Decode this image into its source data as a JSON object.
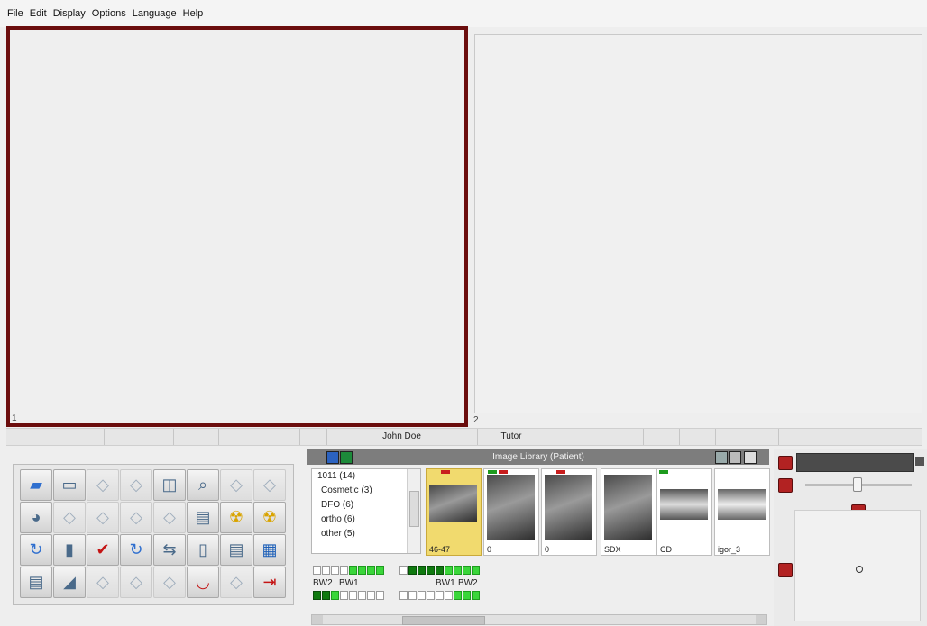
{
  "menu": [
    "File",
    "Edit",
    "Display",
    "Options",
    "Language",
    "Help"
  ],
  "viewports": {
    "left_number": "1",
    "right_number": "2"
  },
  "status": {
    "patient": "John Doe",
    "mode": "Tutor"
  },
  "tools": [
    "cube-icon",
    "monitor-icon",
    "tool-icon",
    "tool-icon",
    "screen-select-icon",
    "magnify-icon",
    "tool-icon",
    "tool-icon",
    "colors-icon",
    "tool-icon",
    "tool-icon",
    "tool-icon",
    "tool-icon",
    "scanner-icon",
    "radiation-icon",
    "radiation-icon",
    "rotate-icon",
    "bottle-icon",
    "checkmark-icon",
    "rotate-icon",
    "transfer-icon",
    "file-icon",
    "document-icon",
    "network-icon",
    "scanner-icon",
    "panorama-icon",
    "tool-icon",
    "tool-icon",
    "tool-icon",
    "mouth-icon",
    "tool-icon",
    "exit-icon"
  ],
  "library": {
    "title": "Image Library (Patient)",
    "categories": [
      "1011 (14)",
      "Cosmetic (3)",
      "DFO (6)",
      "ortho (6)",
      "other (5)"
    ],
    "thumbnails": [
      {
        "caption": "46-47",
        "selected": true
      },
      {
        "caption": "0"
      },
      {
        "caption": "0"
      },
      {
        "caption": "SDX"
      },
      {
        "caption": "CD"
      },
      {
        "caption": "igor_3"
      }
    ],
    "teeth_labels": [
      "BW2",
      "BW1",
      "BW1",
      "BW2"
    ]
  },
  "colors": {
    "accent": "#6b0d0d",
    "selected_thumb": "#f1da6e",
    "green": "#3ad63a",
    "dark_green": "#0f7a0f",
    "red": "#b22222"
  }
}
